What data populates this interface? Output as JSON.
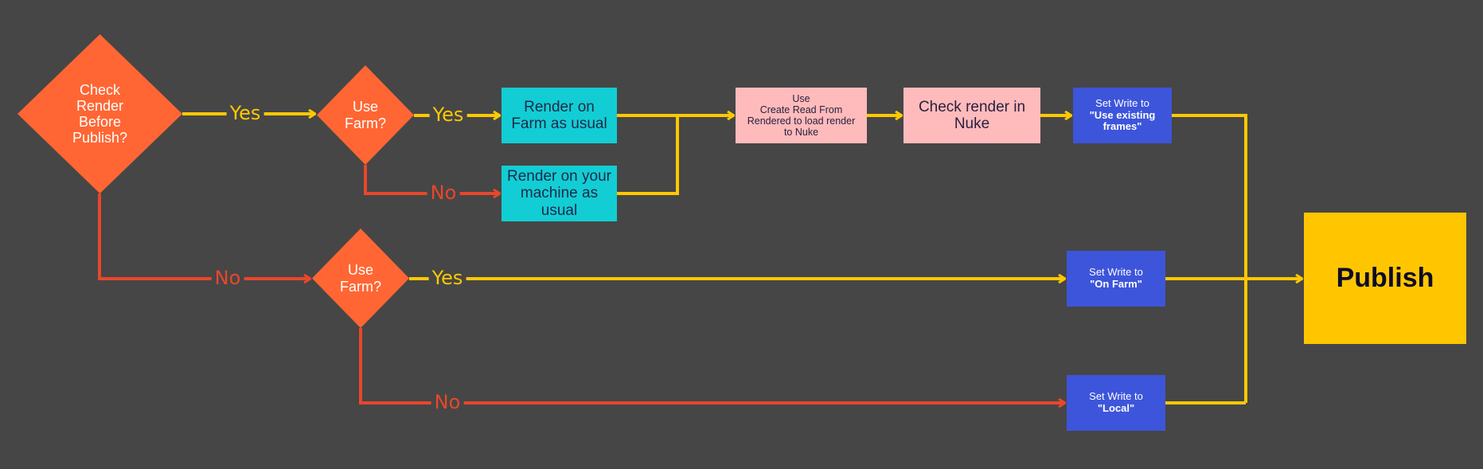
{
  "colors": {
    "background": "#464646",
    "decision": "#FF6633",
    "yes_path": "#FFC800",
    "no_path": "#E8472A",
    "render_box": "#13CDD4",
    "nuke_box": "#FFBBBB",
    "write_box": "#3D55DB",
    "publish_box": "#FFC600"
  },
  "decisions": {
    "check_render": [
      "Check",
      "Render",
      "Before",
      "Publish?"
    ],
    "use_farm_top": [
      "Use",
      "Farm?"
    ],
    "use_farm_bottom": [
      "Use",
      "Farm?"
    ]
  },
  "boxes": {
    "render_farm": [
      "Render on",
      "Farm as usual"
    ],
    "render_local": [
      "Render on your",
      "machine as",
      "usual"
    ],
    "create_read": [
      "Use",
      "Create Read From",
      "Rendered to load render",
      "to Nuke"
    ],
    "check_nuke": [
      "Check render in",
      "Nuke"
    ],
    "write_existing": {
      "line1": "Set Write to",
      "line2": "\"Use existing",
      "line3": "frames\""
    },
    "write_farm": {
      "line1": "Set Write to",
      "line2": "\"On Farm\""
    },
    "write_local": {
      "line1": "Set Write to",
      "line2": "\"Local\""
    },
    "publish": "Publish"
  },
  "edge_labels": {
    "d1_yes": "Yes",
    "d1_no": "No",
    "d2_yes": "Yes",
    "d2_no": "No",
    "d3_yes": "Yes",
    "d3_no": "No"
  }
}
